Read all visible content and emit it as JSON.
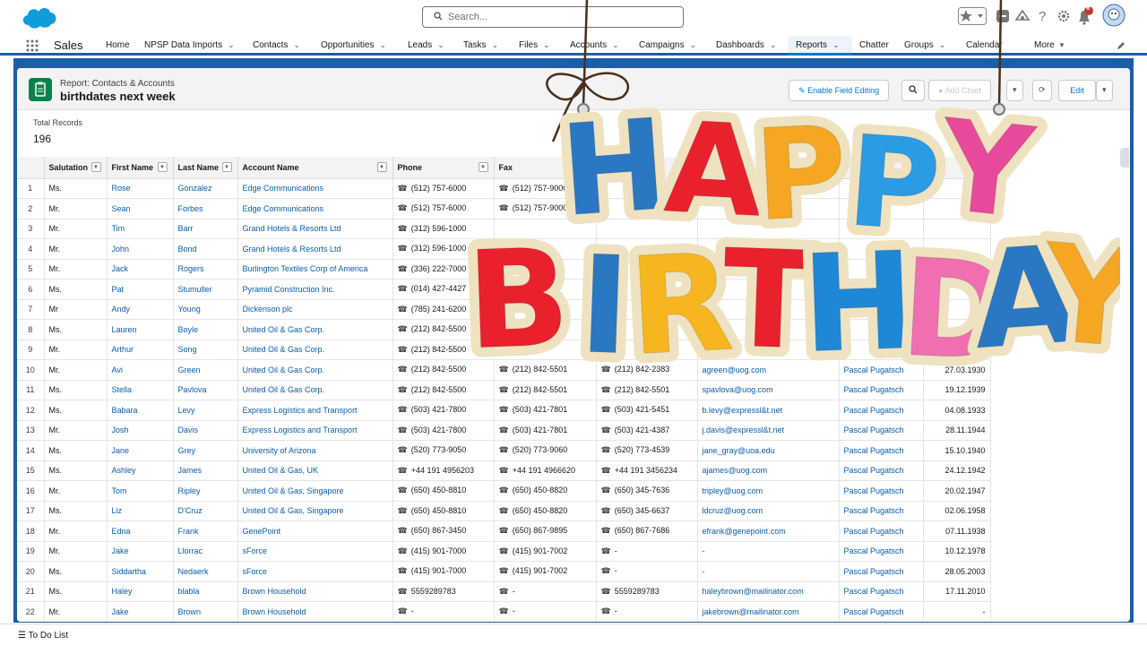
{
  "app": {
    "name": "Sales"
  },
  "search": {
    "placeholder": "Search..."
  },
  "notifications": {
    "count": "6"
  },
  "nav": {
    "items": [
      {
        "label": "Home",
        "dropdown": false
      },
      {
        "label": "NPSP Data Imports",
        "dropdown": true
      },
      {
        "label": "Contacts",
        "dropdown": true
      },
      {
        "label": "Opportunities",
        "dropdown": true
      },
      {
        "label": "Leads",
        "dropdown": true
      },
      {
        "label": "Tasks",
        "dropdown": true
      },
      {
        "label": "Files",
        "dropdown": true
      },
      {
        "label": "Accounts",
        "dropdown": true
      },
      {
        "label": "Campaigns",
        "dropdown": true
      },
      {
        "label": "Dashboards",
        "dropdown": true
      },
      {
        "label": "Reports",
        "dropdown": true
      },
      {
        "label": "Chatter",
        "dropdown": false
      },
      {
        "label": "Groups",
        "dropdown": true
      },
      {
        "label": "Calendar",
        "dropdown": false
      },
      {
        "label": "More",
        "dropdown": true
      }
    ]
  },
  "report": {
    "type_label": "Report: Contacts & Accounts",
    "title": "birthdates next week",
    "enable_field_editing": "Enable Field Editing",
    "add_chart": "Add Chart",
    "edit": "Edit",
    "total_records_label": "Total Records",
    "total_records": "196"
  },
  "table": {
    "columns": [
      "Salutation",
      "First Name",
      "Last Name",
      "Account Name",
      "Phone",
      "Fax"
    ],
    "rows": [
      [
        "1",
        "Ms.",
        "Rose",
        "Gonzalez",
        "Edge Communications",
        "(512) 757-6000",
        "(512) 757-9000",
        "",
        "",
        "",
        ""
      ],
      [
        "2",
        "Mr.",
        "Sean",
        "Forbes",
        "Edge Communications",
        "(512) 757-6000",
        "(512) 757-9000",
        "",
        "",
        "",
        ""
      ],
      [
        "3",
        "Mr.",
        "Tim",
        "Barr",
        "Grand Hotels & Resorts Ltd",
        "(312) 596-1000",
        "",
        "",
        "",
        "",
        ""
      ],
      [
        "4",
        "Mr.",
        "John",
        "Bond",
        "Grand Hotels & Resorts Ltd",
        "(312) 596-1000",
        "",
        "",
        "",
        "",
        ""
      ],
      [
        "5",
        "Mr.",
        "Jack",
        "Rogers",
        "Burlington Textiles Corp of America",
        "(336) 222-7000",
        "",
        "",
        "",
        "",
        ""
      ],
      [
        "6",
        "Ms.",
        "Pat",
        "Stumuller",
        "Pyramid Construction Inc.",
        "(014) 427-4427",
        "",
        "",
        "",
        "",
        ""
      ],
      [
        "7",
        "Mr",
        "Andy",
        "Young",
        "Dickenson plc",
        "(785) 241-6200",
        "",
        "",
        "",
        "",
        ""
      ],
      [
        "8",
        "Ms.",
        "Lauren",
        "Boyle",
        "United Oil & Gas Corp.",
        "(212) 842-5500",
        "",
        "",
        "",
        "",
        ""
      ],
      [
        "9",
        "Mr.",
        "Arthur",
        "Song",
        "United Oil & Gas Corp.",
        "(212) 842-5500",
        "",
        "",
        "",
        "",
        ""
      ],
      [
        "10",
        "Mr.",
        "Avi",
        "Green",
        "United Oil & Gas Corp.",
        "(212) 842-5500",
        "(212) 842-5501",
        "(212) 842-2383",
        "agreen@uog.com",
        "Pascal Pugatsch",
        "27.03.1930"
      ],
      [
        "11",
        "Ms.",
        "Stella",
        "Pavlova",
        "United Oil & Gas Corp.",
        "(212) 842-5500",
        "(212) 842-5501",
        "(212) 842-5501",
        "spavlova@uog.com",
        "Pascal Pugatsch",
        "19.12.1939"
      ],
      [
        "12",
        "Ms.",
        "Babara",
        "Levy",
        "Express Logistics and Transport",
        "(503) 421-7800",
        "(503) 421-7801",
        "(503) 421-5451",
        "b.levy@expressl&t.net",
        "Pascal Pugatsch",
        "04.08.1933"
      ],
      [
        "13",
        "Mr.",
        "Josh",
        "Davis",
        "Express Logistics and Transport",
        "(503) 421-7800",
        "(503) 421-7801",
        "(503) 421-4387",
        "j.davis@expressl&t.net",
        "Pascal Pugatsch",
        "28.11.1944"
      ],
      [
        "14",
        "Ms.",
        "Jane",
        "Grey",
        "University of Arizona",
        "(520) 773-9050",
        "(520) 773-9060",
        "(520) 773-4539",
        "jane_gray@uoa.edu",
        "Pascal Pugatsch",
        "15.10.1940"
      ],
      [
        "15",
        "Ms.",
        "Ashley",
        "James",
        "United Oil & Gas, UK",
        "+44 191 4956203",
        "+44 191 4966620",
        "+44 191 3456234",
        "ajames@uog.com",
        "Pascal Pugatsch",
        "24.12.1942"
      ],
      [
        "16",
        "Mr.",
        "Tom",
        "Ripley",
        "United Oil & Gas, Singapore",
        "(650) 450-8810",
        "(650) 450-8820",
        "(650) 345-7636",
        "tripley@uog.com",
        "Pascal Pugatsch",
        "20.02.1947"
      ],
      [
        "17",
        "Ms.",
        "Liz",
        "D'Cruz",
        "United Oil & Gas, Singapore",
        "(650) 450-8810",
        "(650) 450-8820",
        "(650) 345-6637",
        "ldcruz@uog.com",
        "Pascal Pugatsch",
        "02.06.1958"
      ],
      [
        "18",
        "Mr.",
        "Edna",
        "Frank",
        "GenePoint",
        "(650) 867-3450",
        "(650) 867-9895",
        "(650) 867-7686",
        "efrank@genepoint.com",
        "Pascal Pugatsch",
        "07.11.1938"
      ],
      [
        "19",
        "Mr.",
        "Jake",
        "Llorrac",
        "sForce",
        "(415) 901-7000",
        "(415) 901-7002",
        "-",
        "-",
        "Pascal Pugatsch",
        "10.12.1978"
      ],
      [
        "20",
        "Ms.",
        "Siddartha",
        "Nedaerk",
        "sForce",
        "(415) 901-7000",
        "(415) 901-7002",
        "-",
        "-",
        "Pascal Pugatsch",
        "28.05.2003"
      ],
      [
        "21",
        "Ms.",
        "Haley",
        "blabla",
        "Brown Household",
        "5559289783",
        "-",
        "5559289783",
        "haleybrown@mailinator.com",
        "Pascal Pugatsch",
        "17.11.2010"
      ],
      [
        "22",
        "Mr.",
        "Jake",
        "Brown",
        "Brown Household",
        "-",
        "-",
        "-",
        "jakebrown@mailinator.com",
        "Pascal Pugatsch",
        "-"
      ]
    ]
  },
  "overlay": {
    "line1": "HAPPY",
    "line2": "BIRTHDAY",
    "letter_colors": [
      "#2b78c2",
      "#e8212d",
      "#f5a623",
      "#2b9be3",
      "#e74a9b",
      "#e8212d",
      "#2b78c2",
      "#f5b61f",
      "#e8212d",
      "#1e88d6",
      "#ef6fb1",
      "#2b78c2",
      "#f5a623"
    ]
  },
  "footer": {
    "todo": "To Do List"
  }
}
